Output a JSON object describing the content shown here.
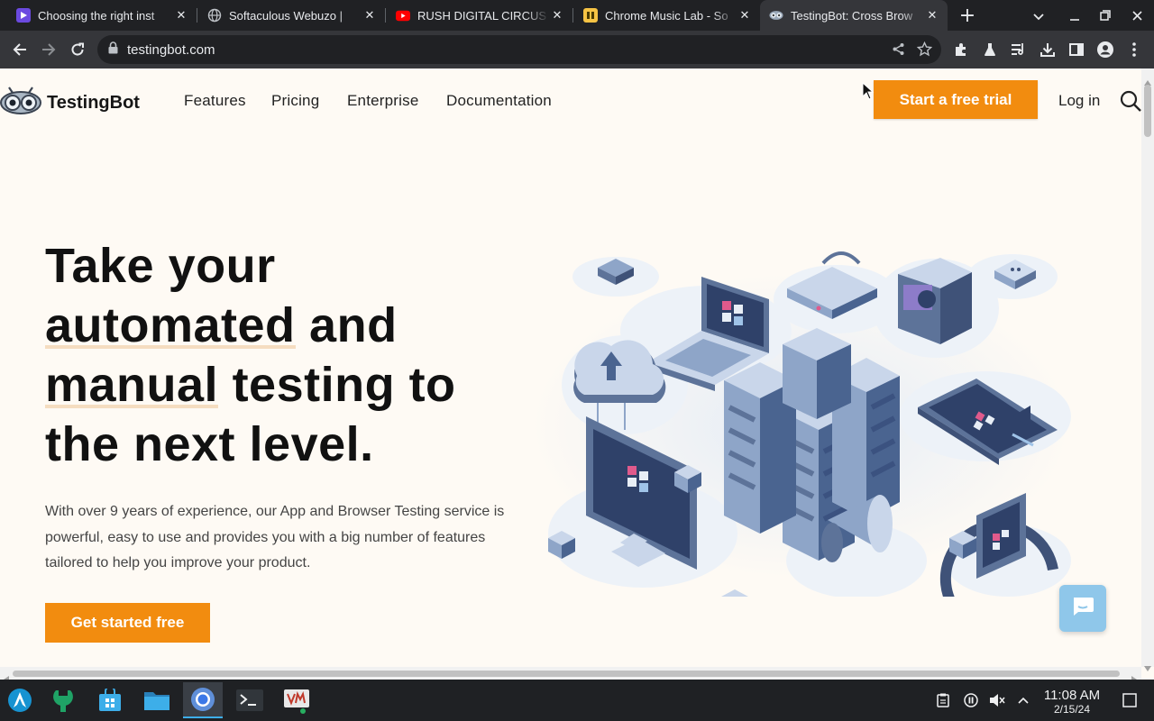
{
  "browser": {
    "tabs": [
      {
        "title": "Choosing the right inst",
        "icon": "video-app-icon",
        "active": false
      },
      {
        "title": "Softaculous Webuzo | ",
        "icon": "globe-icon",
        "active": false
      },
      {
        "title": "RUSH DIGITAL CIRCUS",
        "icon": "youtube-icon",
        "active": false
      },
      {
        "title": "Chrome Music Lab - So",
        "icon": "music-lab-icon",
        "active": false
      },
      {
        "title": "TestingBot: Cross Brow",
        "icon": "testingbot-favicon",
        "active": true
      }
    ],
    "url": "testingbot.com",
    "colors": {
      "frame": "#202124",
      "toolbar": "#35363a"
    }
  },
  "site": {
    "brand": "TestingBot",
    "nav": [
      "Features",
      "Pricing",
      "Enterprise",
      "Documentation"
    ],
    "trial_label": "Start a free trial",
    "login_label": "Log in",
    "hero": {
      "line1": "Take your",
      "line2a": "automated",
      "line2b": " and",
      "line3a": "manual",
      "line3b": " testing to",
      "line4": "the next level."
    },
    "lead": "With over 9 years of experience, our App and Browser Testing service is powerful, easy to use and provides you with a big number of features tailored to help you improve your product.",
    "cta_label": "Get started free",
    "colors": {
      "accent": "#f28c0f",
      "background": "#fefaf4",
      "illustration": "#4a6490",
      "chat": "#8fc7ea"
    }
  },
  "taskbar": {
    "time": "11:08 AM",
    "date": "2/15/24"
  }
}
